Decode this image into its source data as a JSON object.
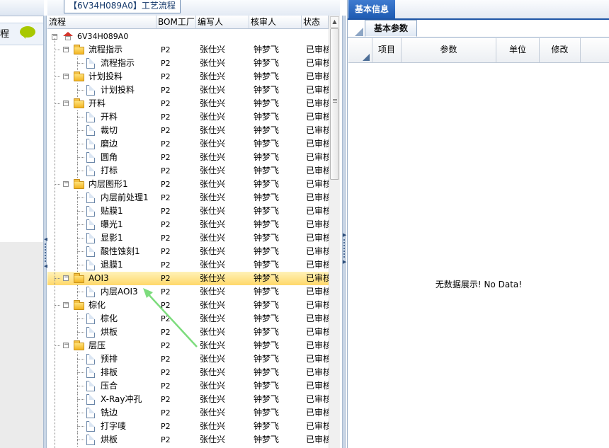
{
  "left_panel": {
    "label": "程"
  },
  "middle": {
    "title": "【6V34H089A0】工艺流程",
    "columns": [
      "流程",
      "BOM工厂",
      "编写人",
      "核审人",
      "状态"
    ],
    "root": "6V34H089A0",
    "rows": [
      {
        "label": "流程指示",
        "level": 1,
        "type": "folder",
        "bom": "P2",
        "writer": "张仕兴",
        "reviewer": "钟梦飞",
        "status": "已审核"
      },
      {
        "label": "流程指示",
        "level": 2,
        "type": "doc",
        "bom": "P2",
        "writer": "张仕兴",
        "reviewer": "钟梦飞",
        "status": "已审核"
      },
      {
        "label": "计划投料",
        "level": 1,
        "type": "folder",
        "bom": "P2",
        "writer": "张仕兴",
        "reviewer": "钟梦飞",
        "status": "已审核"
      },
      {
        "label": "计划投料",
        "level": 2,
        "type": "doc",
        "bom": "P2",
        "writer": "张仕兴",
        "reviewer": "钟梦飞",
        "status": "已审核"
      },
      {
        "label": "开料",
        "level": 1,
        "type": "folder",
        "bom": "P2",
        "writer": "张仕兴",
        "reviewer": "钟梦飞",
        "status": "已审核"
      },
      {
        "label": "开料",
        "level": 2,
        "type": "doc",
        "bom": "P2",
        "writer": "张仕兴",
        "reviewer": "钟梦飞",
        "status": "已审核"
      },
      {
        "label": "裁切",
        "level": 2,
        "type": "doc",
        "bom": "P2",
        "writer": "张仕兴",
        "reviewer": "钟梦飞",
        "status": "已审核"
      },
      {
        "label": "磨边",
        "level": 2,
        "type": "doc",
        "bom": "P2",
        "writer": "张仕兴",
        "reviewer": "钟梦飞",
        "status": "已审核"
      },
      {
        "label": "圆角",
        "level": 2,
        "type": "doc",
        "bom": "P2",
        "writer": "张仕兴",
        "reviewer": "钟梦飞",
        "status": "已审核"
      },
      {
        "label": "打标",
        "level": 2,
        "type": "doc",
        "bom": "P2",
        "writer": "张仕兴",
        "reviewer": "钟梦飞",
        "status": "已审核"
      },
      {
        "label": "内层图形1",
        "level": 1,
        "type": "folder",
        "bom": "P2",
        "writer": "张仕兴",
        "reviewer": "钟梦飞",
        "status": "已审核"
      },
      {
        "label": "内层前处理1",
        "level": 2,
        "type": "doc",
        "bom": "P2",
        "writer": "张仕兴",
        "reviewer": "钟梦飞",
        "status": "已审核"
      },
      {
        "label": "贴膜1",
        "level": 2,
        "type": "doc",
        "bom": "P2",
        "writer": "张仕兴",
        "reviewer": "钟梦飞",
        "status": "已审核"
      },
      {
        "label": "曝光1",
        "level": 2,
        "type": "doc",
        "bom": "P2",
        "writer": "张仕兴",
        "reviewer": "钟梦飞",
        "status": "已审核"
      },
      {
        "label": "显影1",
        "level": 2,
        "type": "doc",
        "bom": "P2",
        "writer": "张仕兴",
        "reviewer": "钟梦飞",
        "status": "已审核"
      },
      {
        "label": "酸性蚀刻1",
        "level": 2,
        "type": "doc",
        "bom": "P2",
        "writer": "张仕兴",
        "reviewer": "钟梦飞",
        "status": "已审核"
      },
      {
        "label": "退膜1",
        "level": 2,
        "type": "doc",
        "bom": "P2",
        "writer": "张仕兴",
        "reviewer": "钟梦飞",
        "status": "已审核"
      },
      {
        "label": "AOI3",
        "level": 1,
        "type": "folder",
        "bom": "P2",
        "writer": "张仕兴",
        "reviewer": "钟梦飞",
        "status": "已审核",
        "selected": true
      },
      {
        "label": "内层AOI3",
        "level": 2,
        "type": "doc",
        "bom": "P2",
        "writer": "张仕兴",
        "reviewer": "钟梦飞",
        "status": "已审核"
      },
      {
        "label": "棕化",
        "level": 1,
        "type": "folder",
        "bom": "P2",
        "writer": "张仕兴",
        "reviewer": "钟梦飞",
        "status": "已审核"
      },
      {
        "label": "棕化",
        "level": 2,
        "type": "doc",
        "bom": "P2",
        "writer": "张仕兴",
        "reviewer": "钟梦飞",
        "status": "已审核"
      },
      {
        "label": "烘板",
        "level": 2,
        "type": "doc",
        "bom": "P2",
        "writer": "张仕兴",
        "reviewer": "钟梦飞",
        "status": "已审核"
      },
      {
        "label": "层压",
        "level": 1,
        "type": "folder",
        "bom": "P2",
        "writer": "张仕兴",
        "reviewer": "钟梦飞",
        "status": "已审核"
      },
      {
        "label": "预排",
        "level": 2,
        "type": "doc",
        "bom": "P2",
        "writer": "张仕兴",
        "reviewer": "钟梦飞",
        "status": "已审核"
      },
      {
        "label": "排板",
        "level": 2,
        "type": "doc",
        "bom": "P2",
        "writer": "张仕兴",
        "reviewer": "钟梦飞",
        "status": "已审核"
      },
      {
        "label": "压合",
        "level": 2,
        "type": "doc",
        "bom": "P2",
        "writer": "张仕兴",
        "reviewer": "钟梦飞",
        "status": "已审核"
      },
      {
        "label": "X-Ray冲孔",
        "level": 2,
        "type": "doc",
        "bom": "P2",
        "writer": "张仕兴",
        "reviewer": "钟梦飞",
        "status": "已审核"
      },
      {
        "label": "铣边",
        "level": 2,
        "type": "doc",
        "bom": "P2",
        "writer": "张仕兴",
        "reviewer": "钟梦飞",
        "status": "已审核"
      },
      {
        "label": "打字唛",
        "level": 2,
        "type": "doc",
        "bom": "P2",
        "writer": "张仕兴",
        "reviewer": "钟梦飞",
        "status": "已审核"
      },
      {
        "label": "烘板",
        "level": 2,
        "type": "doc",
        "bom": "P2",
        "writer": "张仕兴",
        "reviewer": "钟梦飞",
        "status": "已审核"
      }
    ]
  },
  "right": {
    "tab_main": "基本信息",
    "tab_sub": "基本参数",
    "columns": [
      "项目",
      "参数",
      "单位",
      "修改"
    ],
    "empty_text": "无数据展示! No Data!"
  },
  "colors": {
    "accent": "#1e5bb2",
    "selected_row": "#ffd86a",
    "annotation_arrow": "#7ddc7d"
  },
  "icons": [
    "home-icon",
    "folder-icon",
    "document-icon",
    "chat-bubble-icon",
    "scroll-up-icon",
    "splitter-grip-icon"
  ]
}
